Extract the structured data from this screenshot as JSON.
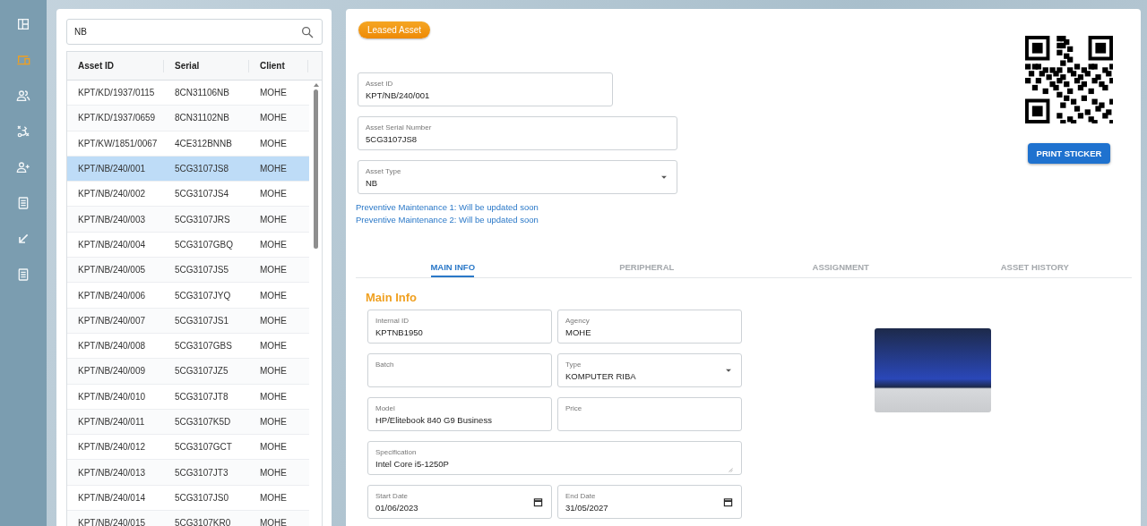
{
  "sidebar": {
    "items": [
      {
        "selected": false
      },
      {
        "selected": true
      },
      {
        "selected": false
      },
      {
        "selected": false
      },
      {
        "selected": false
      },
      {
        "selected": false
      },
      {
        "selected": false
      },
      {
        "selected": false
      }
    ]
  },
  "asset_list": {
    "search": {
      "value": "NB"
    },
    "columns": [
      "Asset ID",
      "Serial",
      "Client"
    ],
    "rows": [
      {
        "cells": [
          "KPT/KD/1937/0115",
          "8CN31106NB",
          "MOHE"
        ],
        "selected": false
      },
      {
        "cells": [
          "KPT/KD/1937/0659",
          "8CN31102NB",
          "MOHE"
        ],
        "selected": false
      },
      {
        "cells": [
          "KPT/KW/1851/0067",
          "4CE312BNNB",
          "MOHE"
        ],
        "selected": false
      },
      {
        "cells": [
          "KPT/NB/240/001",
          "5CG3107JS8",
          "MOHE"
        ],
        "selected": true
      },
      {
        "cells": [
          "KPT/NB/240/002",
          "5CG3107JS4",
          "MOHE"
        ],
        "selected": false
      },
      {
        "cells": [
          "KPT/NB/240/003",
          "5CG3107JRS",
          "MOHE"
        ],
        "selected": false
      },
      {
        "cells": [
          "KPT/NB/240/004",
          "5CG3107GBQ",
          "MOHE"
        ],
        "selected": false
      },
      {
        "cells": [
          "KPT/NB/240/005",
          "5CG3107JS5",
          "MOHE"
        ],
        "selected": false
      },
      {
        "cells": [
          "KPT/NB/240/006",
          "5CG3107JYQ",
          "MOHE"
        ],
        "selected": false
      },
      {
        "cells": [
          "KPT/NB/240/007",
          "5CG3107JS1",
          "MOHE"
        ],
        "selected": false
      },
      {
        "cells": [
          "KPT/NB/240/008",
          "5CG3107GBS",
          "MOHE"
        ],
        "selected": false
      },
      {
        "cells": [
          "KPT/NB/240/009",
          "5CG3107JZ5",
          "MOHE"
        ],
        "selected": false
      },
      {
        "cells": [
          "KPT/NB/240/010",
          "5CG3107JT8",
          "MOHE"
        ],
        "selected": false
      },
      {
        "cells": [
          "KPT/NB/240/011",
          "5CG3107K5D",
          "MOHE"
        ],
        "selected": false
      },
      {
        "cells": [
          "KPT/NB/240/012",
          "5CG3107GCT",
          "MOHE"
        ],
        "selected": false
      },
      {
        "cells": [
          "KPT/NB/240/013",
          "5CG3107JT3",
          "MOHE"
        ],
        "selected": false
      },
      {
        "cells": [
          "KPT/NB/240/014",
          "5CG3107JS0",
          "MOHE"
        ],
        "selected": false
      },
      {
        "cells": [
          "KPT/NB/240/015",
          "5CG3107KR0",
          "MOHE"
        ],
        "selected": false
      }
    ]
  },
  "detail": {
    "badge": "Leased Asset",
    "print_button": "PRINT STICKER",
    "fields": [
      {
        "label": "Asset ID",
        "value": "KPT/NB/240/001",
        "kind": "text"
      },
      {
        "label": "Asset Serial Number",
        "value": "5CG3107JS8",
        "kind": "text"
      },
      {
        "label": "Asset Type",
        "value": "NB",
        "kind": "select"
      }
    ],
    "notes": [
      "Preventive Maintenance 1: Will be updated soon",
      "Preventive Maintenance 2: Will be updated soon"
    ],
    "tabs": [
      {
        "label": "MAIN INFO",
        "selected": true
      },
      {
        "label": "PERIPHERAL",
        "selected": false
      },
      {
        "label": "ASSIGNMENT",
        "selected": false
      },
      {
        "label": "ASSET HISTORY",
        "selected": false
      }
    ],
    "main_info": {
      "title": "Main Info",
      "fields": [
        {
          "label": "Internal ID",
          "value": "KPTNB1950",
          "kind": "text"
        },
        {
          "label": "Agency",
          "value": "MOHE",
          "kind": "text"
        },
        {
          "label": "Batch",
          "kind": "text"
        },
        {
          "label": "Type",
          "value": "KOMPUTER RIBA",
          "kind": "select"
        },
        {
          "label": "Model",
          "value": "HP/Elitebook 840 G9 Business",
          "kind": "text"
        },
        {
          "label": "Price",
          "kind": "text"
        },
        {
          "label": "Specification",
          "value": "Intel Core i5-1250P",
          "kind": "textarea"
        },
        {
          "label": "Start Date",
          "value": "01/06/2023",
          "kind": "date"
        },
        {
          "label": "End Date",
          "value": "31/05/2027",
          "kind": "date"
        }
      ]
    }
  }
}
